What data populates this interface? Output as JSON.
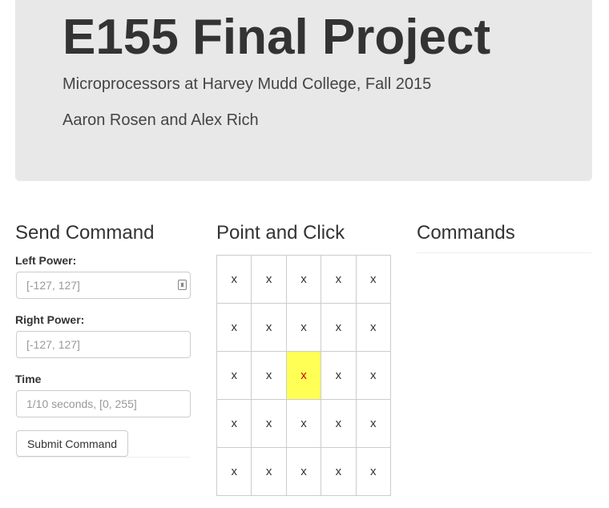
{
  "header": {
    "title": "E155 Final Project",
    "subtitle": "Microprocessors at Harvey Mudd College, Fall 2015",
    "authors": "Aaron Rosen and Alex Rich"
  },
  "send_command": {
    "heading": "Send Command",
    "left_power": {
      "label": "Left Power:",
      "placeholder": "[-127, 127]",
      "value": ""
    },
    "right_power": {
      "label": "Right Power:",
      "placeholder": "[-127, 127]",
      "value": ""
    },
    "time": {
      "label": "Time",
      "placeholder": "1/10 seconds, [0, 255]",
      "value": ""
    },
    "submit_label": "Submit Command"
  },
  "point_and_click": {
    "heading": "Point and Click",
    "selected": {
      "row": 2,
      "col": 2
    },
    "rows": [
      [
        "x",
        "x",
        "x",
        "x",
        "x"
      ],
      [
        "x",
        "x",
        "x",
        "x",
        "x"
      ],
      [
        "x",
        "x",
        "x",
        "x",
        "x"
      ],
      [
        "x",
        "x",
        "x",
        "x",
        "x"
      ],
      [
        "x",
        "x",
        "x",
        "x",
        "x"
      ]
    ]
  },
  "commands": {
    "heading": "Commands",
    "items": []
  },
  "colors": {
    "jumbotron_bg": "#e8e8e8",
    "selected_cell_bg": "#ffff55",
    "selected_cell_text": "#d40000"
  }
}
